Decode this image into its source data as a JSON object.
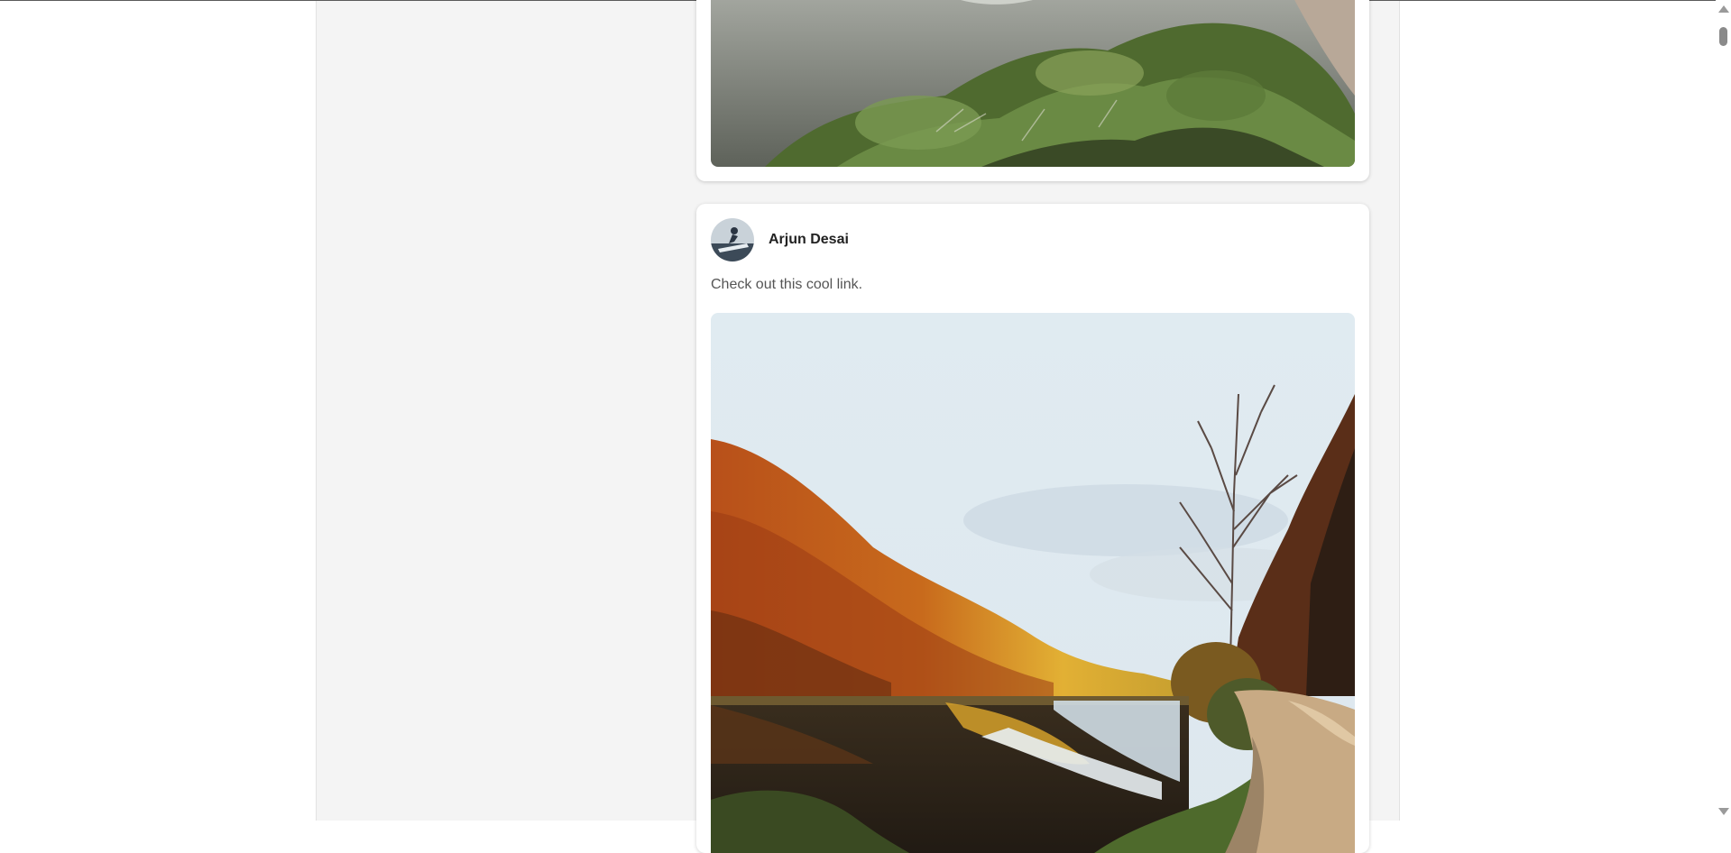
{
  "feed": {
    "posts": [
      {
        "image": {
          "description": "moss-covered rocky hillside in mist",
          "colors": {
            "mist": "#8c9088",
            "moss": "#5c7a3a",
            "shadow": "#2f3a22",
            "rock": "#b8a898"
          }
        }
      },
      {
        "author": {
          "name": "Arjun Desai",
          "avatar_icon": "user-avatar"
        },
        "text": "Check out this cool link.",
        "image": {
          "description": "autumn hillside reflected in a lake beside a dirt road",
          "colors": {
            "sky": "#e2ecf2",
            "foliage_orange": "#c8701a",
            "foliage_yellow": "#e8b830",
            "water_dark": "#2c2418",
            "road": "#c8aa84",
            "tree": "#4a3a2a"
          }
        }
      }
    ]
  },
  "scrollbar": {
    "up_icon": "scroll-up-arrow-icon",
    "down_icon": "scroll-down-arrow-icon"
  }
}
